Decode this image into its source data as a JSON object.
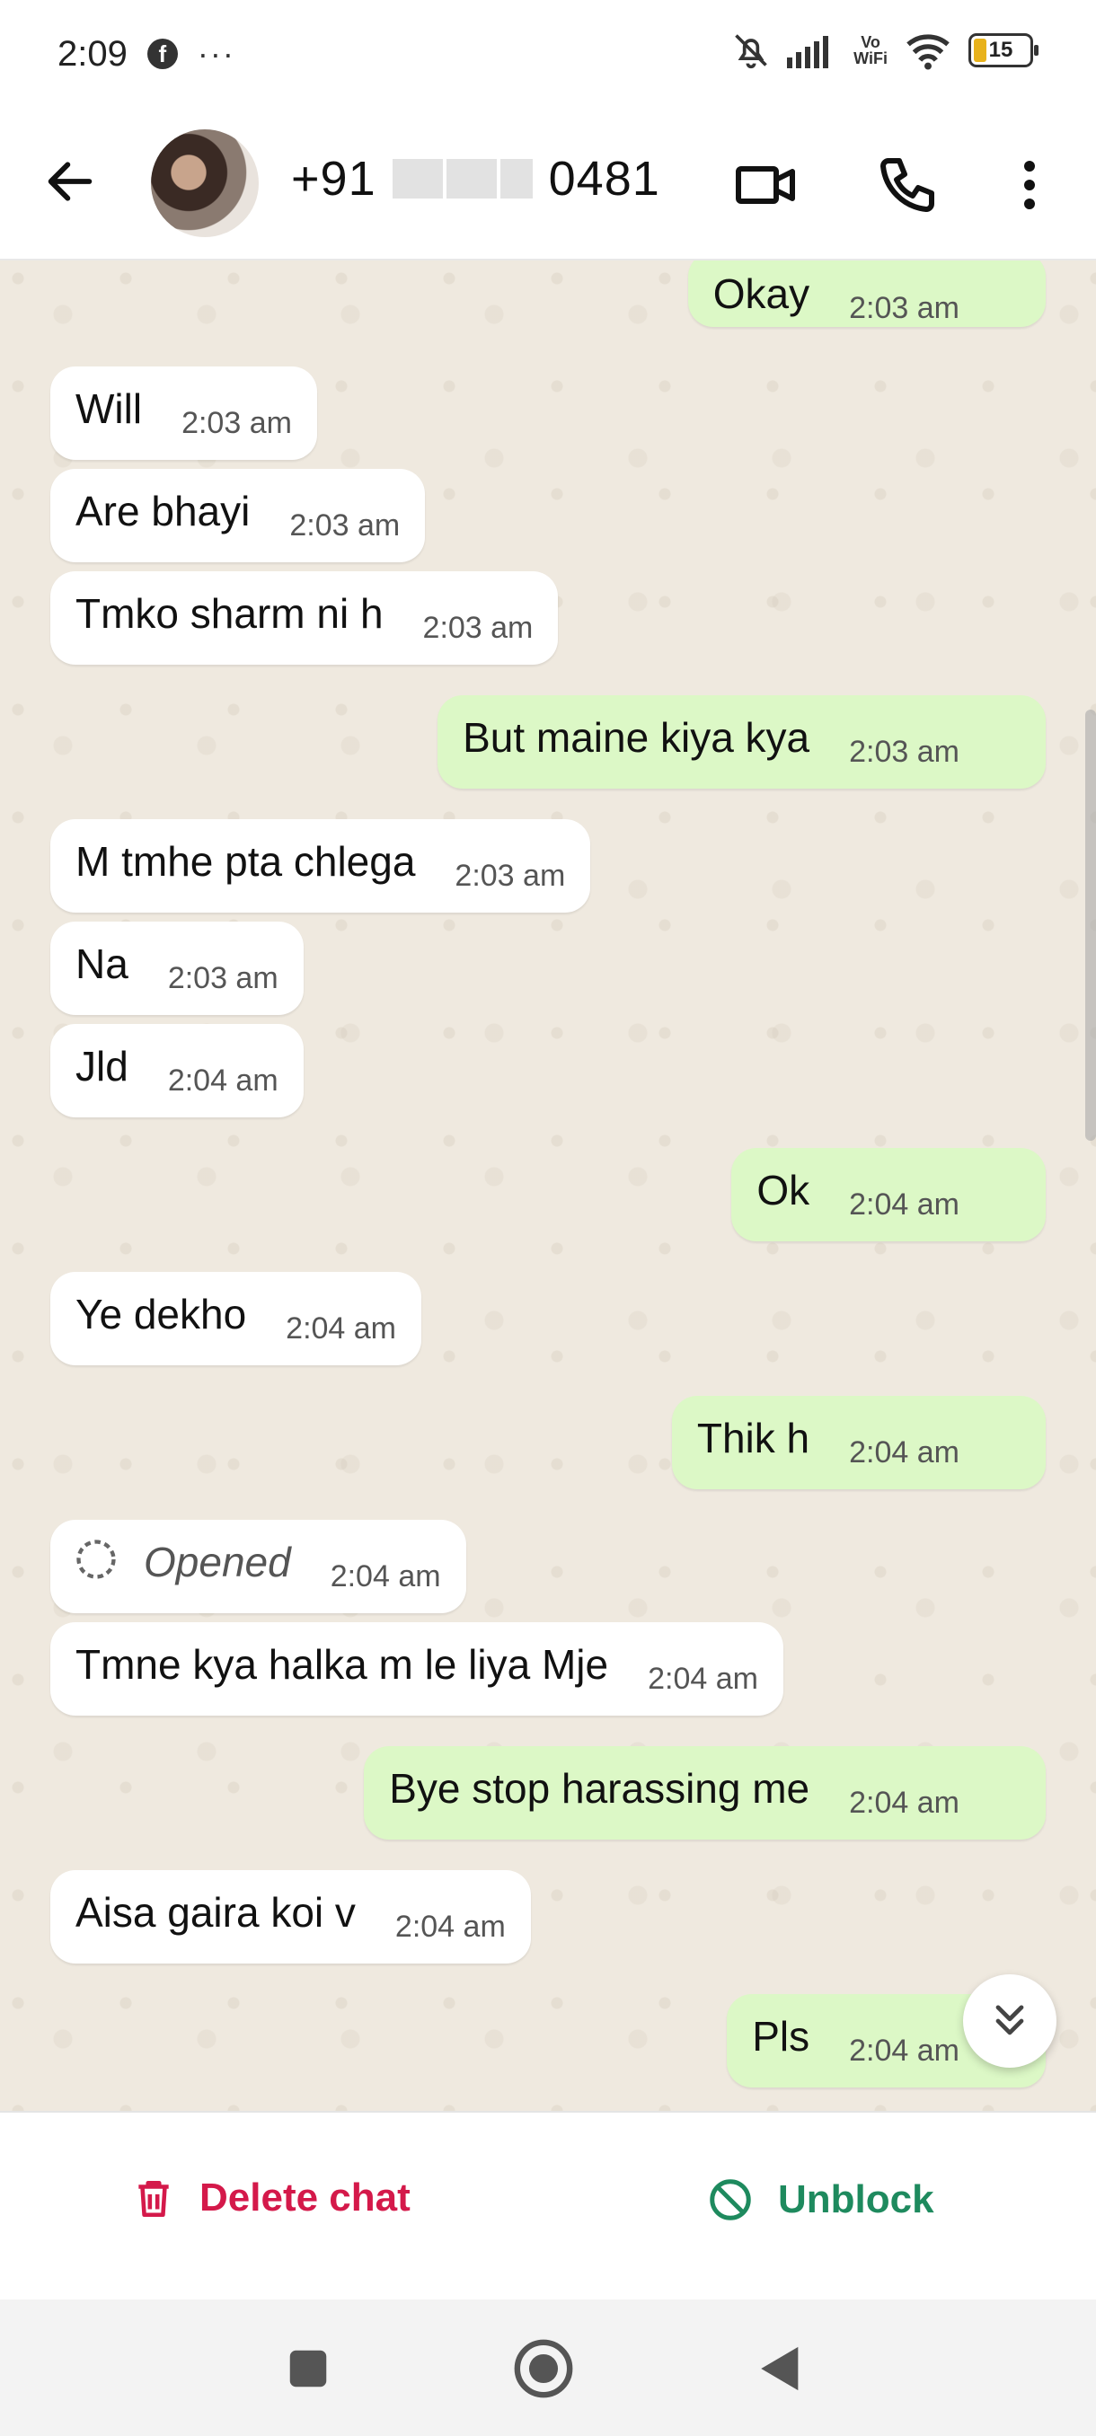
{
  "status_bar": {
    "time": "2:09",
    "battery": "15",
    "vowifi_top": "Vo",
    "vowifi_bottom": "WiFi"
  },
  "header": {
    "contact_prefix": "+91",
    "contact_suffix": "0481"
  },
  "messages": [
    {
      "dir": "out",
      "text": "Okay",
      "time": "2:03 am"
    },
    {
      "dir": "in",
      "text": "Will",
      "time": "2:03 am"
    },
    {
      "dir": "in",
      "text": "Are bhayi",
      "time": "2:03 am"
    },
    {
      "dir": "in",
      "text": "Tmko sharm ni h",
      "time": "2:03 am"
    },
    {
      "dir": "out",
      "text": "But maine kiya kya",
      "time": "2:03 am"
    },
    {
      "dir": "in",
      "text": "M tmhe pta chlega",
      "time": "2:03 am"
    },
    {
      "dir": "in",
      "text": "Na",
      "time": "2:03 am"
    },
    {
      "dir": "in",
      "text": "Jld",
      "time": "2:04 am"
    },
    {
      "dir": "out",
      "text": "Ok",
      "time": "2:04 am"
    },
    {
      "dir": "in",
      "text": "Ye dekho",
      "time": "2:04 am"
    },
    {
      "dir": "out",
      "text": "Thik h",
      "time": "2:04 am"
    },
    {
      "dir": "in",
      "text": "Opened",
      "time": "2:04 am"
    },
    {
      "dir": "in",
      "text": "Tmne kya halka m le liya Mje",
      "time": "2:04 am"
    },
    {
      "dir": "out",
      "text": "Bye stop harassing me",
      "time": "2:04 am"
    },
    {
      "dir": "in",
      "text": "Aisa gaira koi v",
      "time": "2:04 am"
    },
    {
      "dir": "out",
      "text": "Pls",
      "time": "2:04 am"
    }
  ],
  "actions": {
    "delete": "Delete chat",
    "unblock": "Unblock"
  },
  "colors": {
    "delete": "#d4194a",
    "unblock": "#1e8a5e",
    "outgoing_bubble": "#dcf8c6",
    "read_ticks": "#34a0e8"
  },
  "icons": [
    "back-arrow-icon",
    "video-call-icon",
    "phone-icon",
    "more-vert-icon",
    "trash-icon",
    "block-icon",
    "double-chevron-down-icon"
  ]
}
